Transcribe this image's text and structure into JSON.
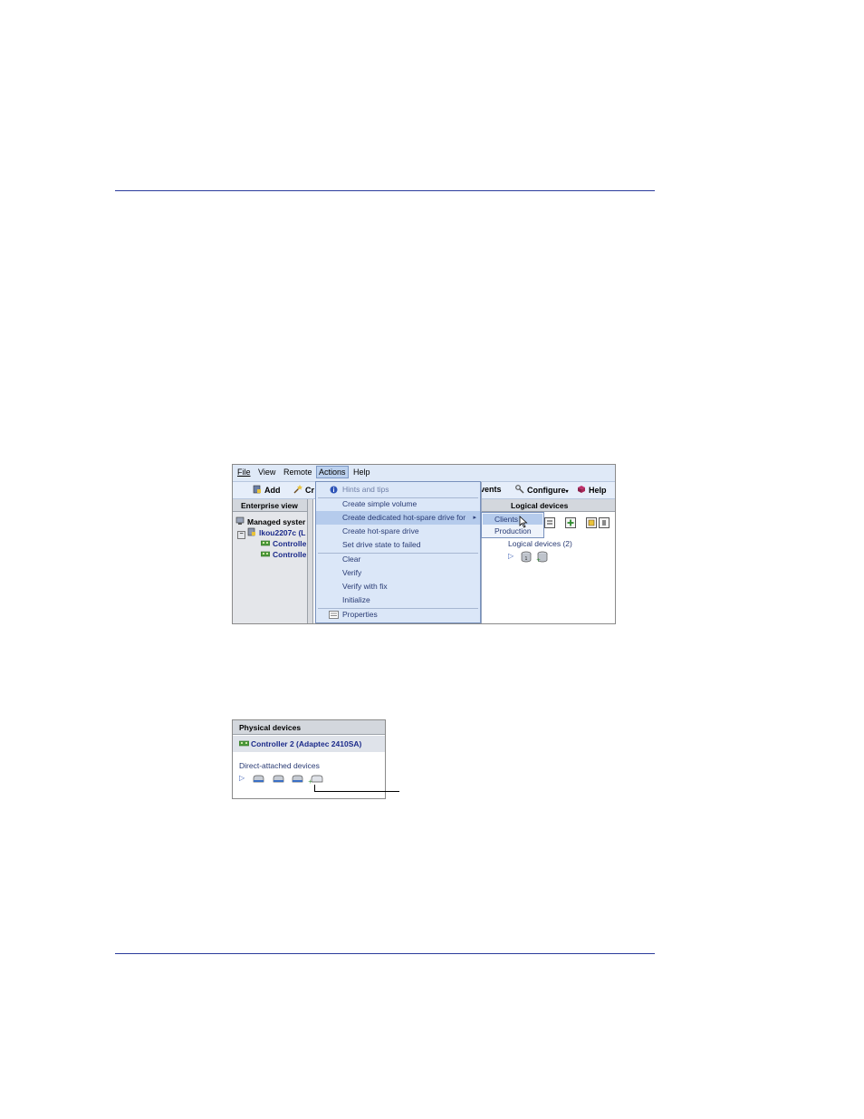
{
  "menubar": {
    "items": [
      "File",
      "View",
      "Remote",
      "Actions",
      "Help"
    ]
  },
  "toolbar": {
    "add": "Add",
    "create": "Cr",
    "events": "vents",
    "configure": "Configure",
    "help": "Help"
  },
  "enterprise_view": {
    "header": "Enterprise view",
    "managed": "Managed syster",
    "host": "lkou2207c (L",
    "controller1": "Controlle",
    "controller2": "Controlle"
  },
  "actions_menu": {
    "items": [
      "Hints and tips",
      "Create simple volume",
      "Create dedicated hot-spare drive for",
      "Create hot-spare drive",
      "Set drive state to failed",
      "Clear",
      "Verify",
      "Verify with fix",
      "Initialize",
      "Properties"
    ]
  },
  "submenu": {
    "items": [
      "Clients",
      "Production"
    ]
  },
  "logical_pane": {
    "header": "Logical devices",
    "group_label": "Logical devices (2)"
  },
  "physical_pane": {
    "header": "Physical devices",
    "controller": "Controller 2 (Adaptec 2410SA)",
    "group_label": "Direct-attached devices"
  },
  "colors": {
    "rule": "#2b3b9c",
    "menu_bg": "#dbe7f8",
    "menu_highlight": "#b5cbec",
    "menu_text": "#283a73"
  }
}
